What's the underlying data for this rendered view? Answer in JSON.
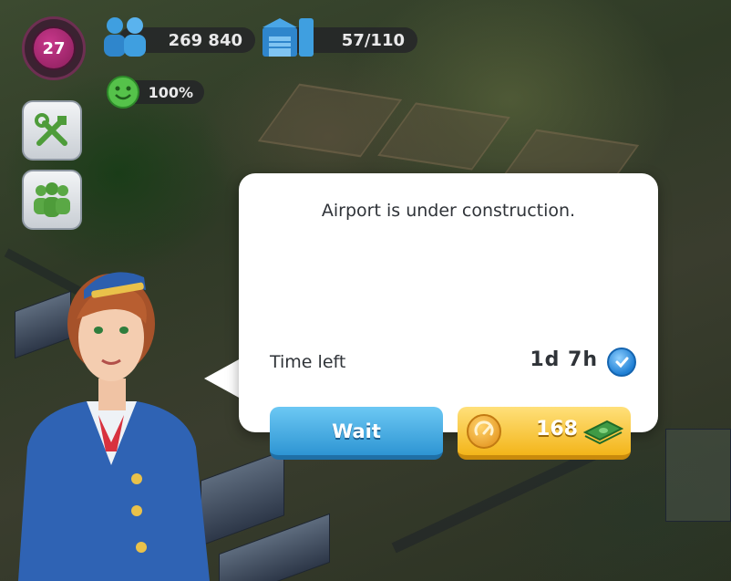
{
  "hud": {
    "level": "27",
    "population": "269 840",
    "storage": "57/110",
    "happiness": "100%"
  },
  "dialog": {
    "title": "Airport is under construction.",
    "time_label": "Time left",
    "time_value": "1d 7h",
    "wait_button": "Wait",
    "speedup_cost": "168"
  },
  "colors": {
    "wait_button": "#2e95d3",
    "speedup_button": "#f3b51a",
    "level_badge": "#c7378a"
  },
  "icons": [
    "population-icon",
    "storage-icon",
    "happiness-icon",
    "tools-icon",
    "community-icon",
    "clock-icon",
    "speedup-icon",
    "money-icon"
  ]
}
